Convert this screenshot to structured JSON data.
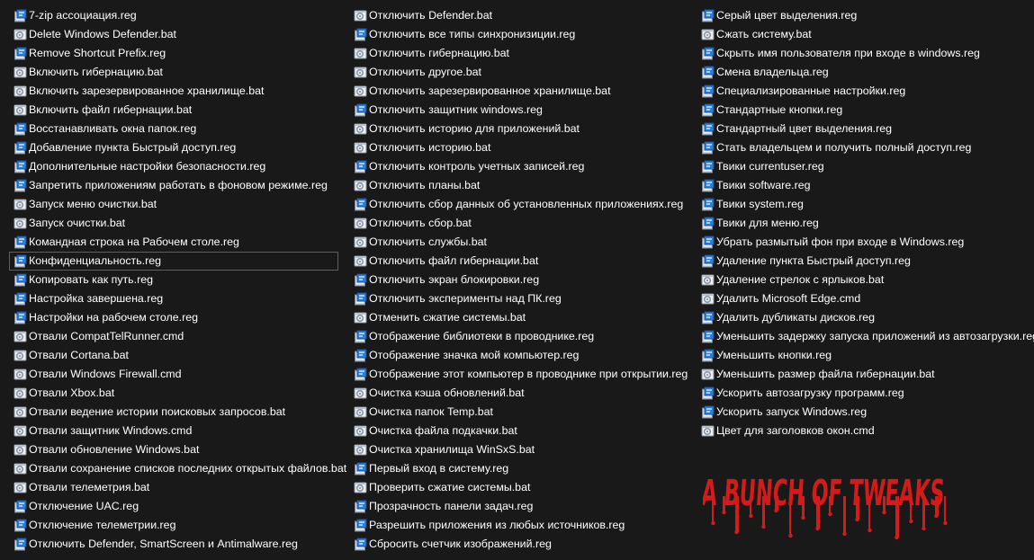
{
  "colors": {
    "background": "#191919",
    "text": "#ffffff",
    "selection_border": "#5f5f5f",
    "logo_red": "#d61a1a"
  },
  "icons": {
    "reg": "registry-file-icon",
    "bat": "batch-file-icon",
    "cmd": "batch-file-icon"
  },
  "columns": [
    {
      "items": [
        {
          "name": "7-zip ассоциация.reg",
          "type": "reg"
        },
        {
          "name": "Delete Windows Defender.bat",
          "type": "bat"
        },
        {
          "name": "Remove Shortcut Prefix.reg",
          "type": "reg"
        },
        {
          "name": "Включить гибернацию.bat",
          "type": "bat"
        },
        {
          "name": "Включить зарезервированное хранилище.bat",
          "type": "bat"
        },
        {
          "name": "Включить файл гибернации.bat",
          "type": "bat"
        },
        {
          "name": "Восстанавливать окна папок.reg",
          "type": "reg"
        },
        {
          "name": "Добавление пункта Быстрый доступ.reg",
          "type": "reg"
        },
        {
          "name": "Дополнительные настройки безопасности.reg",
          "type": "reg"
        },
        {
          "name": "Запретить приложениям работать в фоновом режиме.reg",
          "type": "reg"
        },
        {
          "name": "Запуск меню очистки.bat",
          "type": "bat"
        },
        {
          "name": "Запуск очистки.bat",
          "type": "bat"
        },
        {
          "name": "Командная строка на Рабочем столе.reg",
          "type": "reg"
        },
        {
          "name": "Конфиденциальность.reg",
          "type": "reg",
          "selected": true
        },
        {
          "name": "Копировать как путь.reg",
          "type": "reg"
        },
        {
          "name": "Настройка завершена.reg",
          "type": "reg"
        },
        {
          "name": "Настройки на рабочем столе.reg",
          "type": "reg"
        },
        {
          "name": "Отвали CompatTelRunner.cmd",
          "type": "cmd"
        },
        {
          "name": "Отвали Cortana.bat",
          "type": "bat"
        },
        {
          "name": "Отвали Windows Firewall.cmd",
          "type": "cmd"
        },
        {
          "name": "Отвали Xbox.bat",
          "type": "bat"
        },
        {
          "name": "Отвали ведение истории поисковых запросов.bat",
          "type": "bat"
        },
        {
          "name": "Отвали защитник Windows.cmd",
          "type": "cmd"
        },
        {
          "name": "Отвали обновление Windows.bat",
          "type": "bat"
        },
        {
          "name": "Отвали сохранение списков последних открытых файлов.bat",
          "type": "bat"
        },
        {
          "name": "Отвали телеметрия.bat",
          "type": "bat"
        },
        {
          "name": "Отключение UAC.reg",
          "type": "reg"
        },
        {
          "name": "Отключение телеметрии.reg",
          "type": "reg"
        },
        {
          "name": "Отключить Defender, SmartScreen и Antimalware.reg",
          "type": "reg"
        }
      ]
    },
    {
      "items": [
        {
          "name": "Отключить Defender.bat",
          "type": "bat"
        },
        {
          "name": "Отключить все типы синхронизиции.reg",
          "type": "reg"
        },
        {
          "name": "Отключить гибернацию.bat",
          "type": "bat"
        },
        {
          "name": "Отключить другое.bat",
          "type": "bat"
        },
        {
          "name": "Отключить зарезервированное хранилище.bat",
          "type": "bat"
        },
        {
          "name": "Отключить защитник windows.reg",
          "type": "reg"
        },
        {
          "name": "Отключить историю для приложений.bat",
          "type": "bat"
        },
        {
          "name": "Отключить историю.bat",
          "type": "bat"
        },
        {
          "name": "Отключить контроль учетных записей.reg",
          "type": "reg"
        },
        {
          "name": "Отключить планы.bat",
          "type": "bat"
        },
        {
          "name": "Отключить сбор данных об установленных приложениях.reg",
          "type": "reg"
        },
        {
          "name": "Отключить сбор.bat",
          "type": "bat"
        },
        {
          "name": "Отключить службы.bat",
          "type": "bat"
        },
        {
          "name": "Отключить файл гибернации.bat",
          "type": "bat"
        },
        {
          "name": "Отключить экран блокировки.reg",
          "type": "reg"
        },
        {
          "name": "Отключить эксперименты над ПК.reg",
          "type": "reg"
        },
        {
          "name": "Отменить сжатие системы.bat",
          "type": "bat"
        },
        {
          "name": "Отображение библиотеки в проводнике.reg",
          "type": "reg"
        },
        {
          "name": "Отображение значка мой компьютер.reg",
          "type": "reg"
        },
        {
          "name": "Отображение этот компьютер в проводнике при открытии.reg",
          "type": "reg"
        },
        {
          "name": "Очистка кэша обновлений.bat",
          "type": "bat"
        },
        {
          "name": "Очистка папок Temp.bat",
          "type": "bat"
        },
        {
          "name": "Очистка файла подкачки.bat",
          "type": "bat"
        },
        {
          "name": "Очистка хранилища WinSxS.bat",
          "type": "bat"
        },
        {
          "name": "Первый вход в систему.reg",
          "type": "reg"
        },
        {
          "name": "Проверить сжатие системы.bat",
          "type": "bat"
        },
        {
          "name": "Прозрачность панели задач.reg",
          "type": "reg"
        },
        {
          "name": "Разрешить приложения из любых источников.reg",
          "type": "reg"
        },
        {
          "name": "Сбросить счетчик изображений.reg",
          "type": "reg"
        }
      ]
    },
    {
      "items": [
        {
          "name": "Серый цвет выделения.reg",
          "type": "reg"
        },
        {
          "name": "Сжать систему.bat",
          "type": "bat"
        },
        {
          "name": "Скрыть имя пользователя при входе в windows.reg",
          "type": "reg"
        },
        {
          "name": "Смена владельца.reg",
          "type": "reg"
        },
        {
          "name": "Специализированные настройки.reg",
          "type": "reg"
        },
        {
          "name": "Стандартные кнопки.reg",
          "type": "reg"
        },
        {
          "name": "Стандартный цвет выделения.reg",
          "type": "reg"
        },
        {
          "name": "Стать владельцем и получить полный доступ.reg",
          "type": "reg"
        },
        {
          "name": "Твики currentuser.reg",
          "type": "reg"
        },
        {
          "name": "Твики software.reg",
          "type": "reg"
        },
        {
          "name": "Твики system.reg",
          "type": "reg"
        },
        {
          "name": "Твики для меню.reg",
          "type": "reg"
        },
        {
          "name": "Убрать размытый фон при входе в Windows.reg",
          "type": "reg"
        },
        {
          "name": "Удаление пункта Быстрый доступ.reg",
          "type": "reg"
        },
        {
          "name": "Удаление стрелок с ярлыков.bat",
          "type": "bat"
        },
        {
          "name": "Удалить Microsoft Edge.cmd",
          "type": "cmd"
        },
        {
          "name": "Удалить дубликаты дисков.reg",
          "type": "reg"
        },
        {
          "name": "Уменьшить задержку запуска приложений из автозагрузки.reg",
          "type": "reg"
        },
        {
          "name": "Уменьшить кнопки.reg",
          "type": "reg"
        },
        {
          "name": "Уменьшить размер файла гибернации.bat",
          "type": "bat"
        },
        {
          "name": "Ускорить автозагрузку программ.reg",
          "type": "reg"
        },
        {
          "name": "Ускорить запуск Windows.reg",
          "type": "reg"
        },
        {
          "name": "Цвет для заголовков окон.cmd",
          "type": "cmd"
        }
      ]
    }
  ],
  "logo": {
    "text": "A BUNCH OF TWEAKS",
    "icon": "tweaks-logo"
  }
}
